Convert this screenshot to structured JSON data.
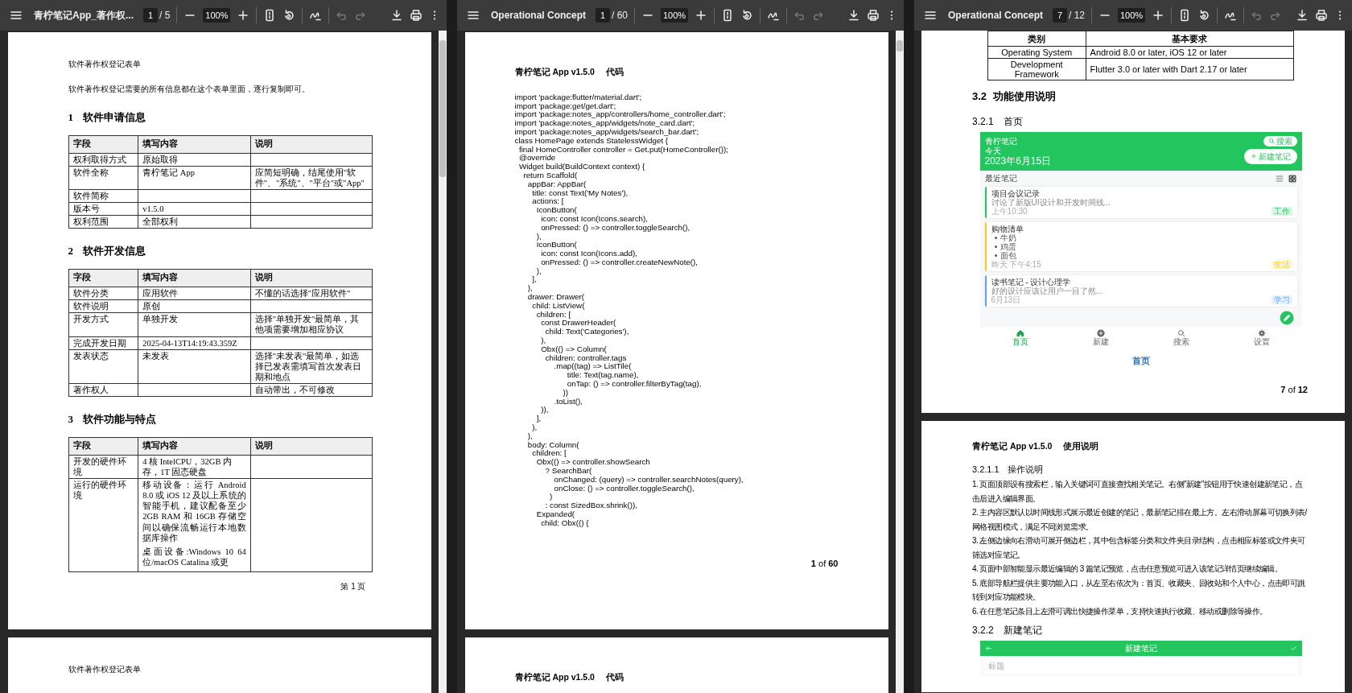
{
  "viewers": [
    {
      "title": "青柠笔记App_著作权...",
      "page": "1",
      "page_count": "/ 5",
      "zoom": "100%",
      "undo_disabled": true,
      "redo_disabled": true,
      "pages": [
        {
          "blocks": [
            {
              "kind": "running_header",
              "text": "软件著作权登记表单"
            },
            {
              "kind": "paragraph",
              "text": "软件著作权登记需要的所有信息都在这个表单里面，逐行复制即可。"
            },
            {
              "kind": "heading",
              "number": "1",
              "text": "软件申请信息"
            },
            {
              "kind": "table",
              "columns": [
                "字段",
                "填写内容",
                "说明"
              ],
              "rows": [
                {
                  "field": "权利取得方式",
                  "value": "原始取得"
                },
                {
                  "field": "软件全称",
                  "value": "青柠笔记 App",
                  "note": "应简短明确，结尾使用\"软件\"、\"系统\"、\"平台\"或\"App\""
                },
                {
                  "field": "软件简称"
                },
                {
                  "field": "版本号",
                  "value": "v1.5.0"
                },
                {
                  "field": "权利范围",
                  "value": "全部权利"
                }
              ]
            },
            {
              "kind": "heading",
              "number": "2",
              "text": "软件开发信息"
            },
            {
              "kind": "table",
              "columns": [
                "字段",
                "填写内容",
                "说明"
              ],
              "rows": [
                {
                  "field": "软件分类",
                  "value": "应用软件",
                  "note": "不懂的话选择\"应用软件\""
                },
                {
                  "field": "软件说明",
                  "value": "原创"
                },
                {
                  "field": "开发方式",
                  "value": "单独开发",
                  "note": "选择\"单独开发\"最简单，其他项需要增加相应协议"
                },
                {
                  "field": "完成开发日期",
                  "value": "2025-04-13T14:19:43.359Z"
                },
                {
                  "field": "发表状态",
                  "value": "未发表",
                  "note": "选择\"未发表\"最简单，如选择已发表需填写首次发表日期和地点"
                },
                {
                  "field": "著作权人",
                  "note": "自动带出，不可修改"
                }
              ]
            },
            {
              "kind": "heading",
              "number": "3",
              "text": "软件功能与特点"
            },
            {
              "kind": "table",
              "columns": [
                "字段",
                "填写内容",
                "说明"
              ],
              "rows": [
                {
                  "field": "开发的硬件环境",
                  "value": "4 核 IntelCPU，32GB 内存，1T 固态硬盘"
                },
                {
                  "field": "运行的硬件环境",
                  "value": [
                    "移动设备：运行 Android 8.0 或 iOS 12 及以上系统的智能手机，建议配备至少 2GB RAM 和 16GB 存储空间以确保流畅运行本地数据库操作",
                    "桌面设备:Windows 10 64位/macOS Catalina 或更"
                  ]
                }
              ]
            },
            {
              "kind": "page_footer",
              "text": "第 1 页"
            }
          ]
        },
        {
          "blocks": [
            {
              "kind": "running_header",
              "text": "软件著作权登记表单"
            }
          ]
        }
      ]
    },
    {
      "title": "Operational Concept",
      "page": "1",
      "page_count": "/ 60",
      "zoom": "100%",
      "undo_disabled": true,
      "redo_disabled": true,
      "pages": [
        {
          "blocks": [
            {
              "kind": "doc_title",
              "title": "青柠笔记 App v1.5.0",
              "section": "代码"
            },
            {
              "kind": "code",
              "lines": [
                "import 'package:flutter/material.dart';",
                "import 'package:get/get.dart';",
                "import 'package:notes_app/controllers/home_controller.dart';",
                "import 'package:notes_app/widgets/note_card.dart';",
                "import 'package:notes_app/widgets/search_bar.dart';",
                "class HomePage extends StatelessWidget {",
                "  final HomeController controller = Get.put(HomeController());",
                "  @override",
                "  Widget build(BuildContext context) {",
                "    return Scaffold(",
                "      appBar: AppBar(",
                "        title: const Text('My Notes'),",
                "        actions: [",
                "          IconButton(",
                "            icon: const Icon(Icons.search),",
                "            onPressed: () => controller.toggleSearch(),",
                "          ),",
                "          IconButton(",
                "            icon: const Icon(Icons.add),",
                "            onPressed: () => controller.createNewNote(),",
                "          ),",
                "        ],",
                "      ),",
                "      drawer: Drawer(",
                "        child: ListView(",
                "          children: [",
                "            const DrawerHeader(",
                "              child: Text('Categories'),",
                "            ),",
                "            Obx(() => Column(",
                "              children: controller.tags",
                "                  .map((tag) => ListTile(",
                "                        title: Text(tag.name),",
                "                        onTap: () => controller.filterByTag(tag),",
                "                      ))",
                "                  .toList(),",
                "            )),",
                "          ],",
                "        ),",
                "      ),",
                "      body: Column(",
                "        children: [",
                "          Obx(() => controller.showSearch",
                "              ? SearchBar(",
                "                  onChanged: (query) => controller.searchNotes(query),",
                "                  onClose: () => controller.toggleSearch(),",
                "                )",
                "              : const SizedBox.shrink()),",
                "          Expanded(",
                "            child: Obx(() {"
              ]
            },
            {
              "kind": "page_number",
              "text": "**1** of **60**"
            }
          ]
        },
        {
          "blocks": [
            {
              "kind": "doc_title",
              "title": "青柠笔记 App v1.5.0",
              "section": "代码"
            }
          ]
        }
      ]
    },
    {
      "title": "Operational Concept",
      "page": "7",
      "page_count": "/ 12",
      "zoom": "100%",
      "undo_disabled": true,
      "redo_disabled": true,
      "pages": [
        {
          "blocks": [
            {
              "kind": "requirements_table",
              "columns": [
                "类别",
                "基本要求"
              ],
              "rows": [
                [
                  "Operating System",
                  "Android 8.0 or later, iOS 12 or later"
                ],
                [
                  "Development Framework",
                  "Flutter 3.0 or later with Dart 2.17 or later"
                ]
              ]
            },
            {
              "kind": "heading2",
              "number": "3.2",
              "text": "功能使用说明"
            },
            {
              "kind": "heading3",
              "number": "3.2.1",
              "text": "首页"
            },
            {
              "kind": "app_home",
              "app_name": "青柠笔记",
              "search": "搜索",
              "date_label": "今天",
              "date": "2023年6月15日",
              "new_button": "新建笔记",
              "section": "最近笔记",
              "view_toggle": [
                {
                  "kind": "list",
                  "selected": false
                },
                {
                  "kind": "grid",
                  "selected": true
                }
              ],
              "notes": [
                {
                  "title": "项目会议记录",
                  "preview": "讨论了新版UI设计和开发时间线...",
                  "time": "上午10:30",
                  "tag": "工作",
                  "color": "#22c55e"
                },
                {
                  "title": "购物清单",
                  "items": [
                    "牛奶",
                    "鸡蛋",
                    "面包"
                  ],
                  "time": "昨天 下午4:15",
                  "tag": "生活",
                  "color": "#facc15"
                },
                {
                  "title": "读书笔记 - 设计心理学",
                  "preview": "好的设计应该让用户一目了然...",
                  "time": "6月13日",
                  "tag": "学习",
                  "color": "#60a5fa"
                }
              ],
              "nav": [
                {
                  "label": "首页",
                  "selected": true
                },
                {
                  "label": "新建",
                  "selected": false
                },
                {
                  "label": "搜索",
                  "selected": false
                },
                {
                  "label": "设置",
                  "selected": false
                }
              ]
            },
            {
              "kind": "caption",
              "text": "首页"
            },
            {
              "kind": "page_number",
              "text": "**7** of **12**"
            }
          ]
        },
        {
          "blocks": [
            {
              "kind": "doc_title",
              "title": "青柠笔记 App v1.5.0",
              "section": "使用说明"
            },
            {
              "kind": "heading4",
              "number": "3.2.1.1",
              "text": "操作说明"
            },
            {
              "kind": "numbered_list",
              "items": [
                "1. 页面顶部设有搜索栏，输入关键词可直接查找相关笔记。右侧\"新建\"按钮用于快速创建新笔记，点击后进入编辑界面。",
                "2. 主内容区默认以时间线形式展示最近创建的笔记，最新笔记排在最上方。左右滑动屏幕可切换列表/网格视图模式，满足不同浏览需求。",
                "3. 左侧边缘向右滑动可展开侧边栏，其中包含标签分类和文件夹目录结构，点击相应标签或文件夹可筛选对应笔记。",
                "4. 页面中部智能显示最近编辑的 3 篇笔记预览，点击任意预览可进入该笔记详情页继续编辑。",
                "5. 底部导航栏提供主要功能入口，从左至右依次为：首页、收藏夹、回收站和个人中心，点击即可跳转到对应功能模块。",
                "6. 在任意笔记条目上左滑可调出快捷操作菜单，支持快速执行收藏、移动或删除等操作。"
              ]
            },
            {
              "kind": "heading3",
              "number": "3.2.2",
              "text": "新建笔记"
            },
            {
              "kind": "app_new",
              "title": "新建笔记",
              "placeholder": "标题"
            }
          ]
        }
      ]
    }
  ]
}
